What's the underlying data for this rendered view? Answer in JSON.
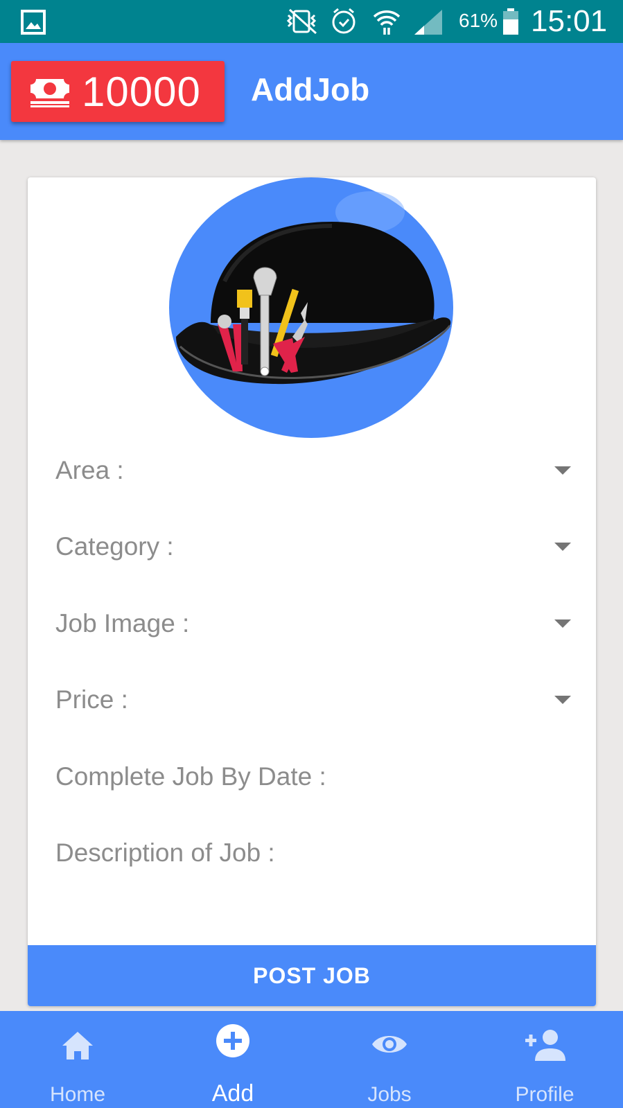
{
  "status_bar": {
    "battery": "61%",
    "time": "15:01",
    "icons": [
      "gallery-icon",
      "vibrate-icon",
      "alarm-icon",
      "wifi-icon",
      "signal-icon",
      "battery-icon"
    ]
  },
  "app_bar": {
    "balance": "10000",
    "balance_icon": "money-icon",
    "title": "AddJob"
  },
  "form": {
    "fields": [
      {
        "label": "Area :",
        "dropdown": true
      },
      {
        "label": "Category :",
        "dropdown": true
      },
      {
        "label": "Job Image :",
        "dropdown": true
      },
      {
        "label": "Price :",
        "dropdown": true
      },
      {
        "label": "Complete Job By Date :",
        "dropdown": false
      },
      {
        "label": "Description of Job :",
        "dropdown": false
      }
    ],
    "submit_label": "POST JOB"
  },
  "bottom_nav": {
    "items": [
      {
        "label": "Home",
        "icon": "home-icon",
        "active": false
      },
      {
        "label": "Add",
        "icon": "add-circle-icon",
        "active": true
      },
      {
        "label": "Jobs",
        "icon": "eye-icon",
        "active": false
      },
      {
        "label": "Profile",
        "icon": "add-person-icon",
        "active": false
      }
    ]
  },
  "colors": {
    "status_bar": "#00838f",
    "primary": "#4a8afa",
    "balance_badge": "#f3373f",
    "background": "#ebe9e8"
  }
}
